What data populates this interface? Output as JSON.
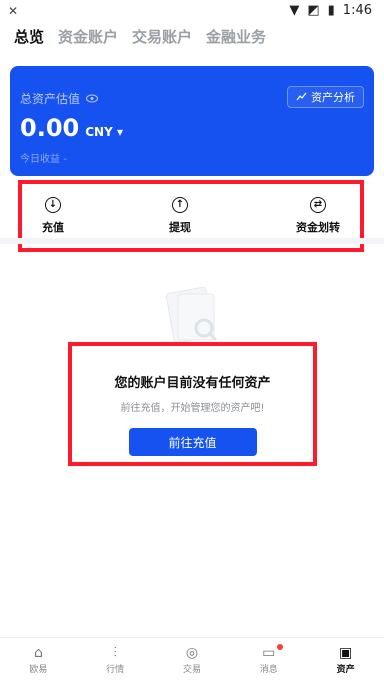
{
  "status_bar": {
    "time": "1:46"
  },
  "tabs": [
    {
      "label": "总览"
    },
    {
      "label": "资金账户"
    },
    {
      "label": "交易账户"
    },
    {
      "label": "金融业务"
    }
  ],
  "card": {
    "title": "总资产估值",
    "amount": "0.00",
    "currency": "CNY",
    "today_label": "今日收益",
    "today_value": "-",
    "analysis_button": "资产分析"
  },
  "actions": [
    {
      "label": "充值",
      "icon": "download-icon"
    },
    {
      "label": "提现",
      "icon": "upload-icon"
    },
    {
      "label": "资金划转",
      "icon": "transfer-icon"
    }
  ],
  "empty_state": {
    "title": "您的账户目前没有任何资产",
    "subtitle": "前往充值，开始管理您的资产吧!",
    "button": "前往充值"
  },
  "bottom_nav": [
    {
      "label": "欧易",
      "icon": "home-icon",
      "active": false
    },
    {
      "label": "行情",
      "icon": "candlestick-icon",
      "active": false
    },
    {
      "label": "交易",
      "icon": "trade-icon",
      "active": false
    },
    {
      "label": "消息",
      "icon": "message-icon",
      "active": false,
      "badge": true
    },
    {
      "label": "资产",
      "icon": "wallet-icon",
      "active": true
    }
  ],
  "colors": {
    "primary": "#1652f0",
    "highlight_border": "#ff1b2b"
  }
}
